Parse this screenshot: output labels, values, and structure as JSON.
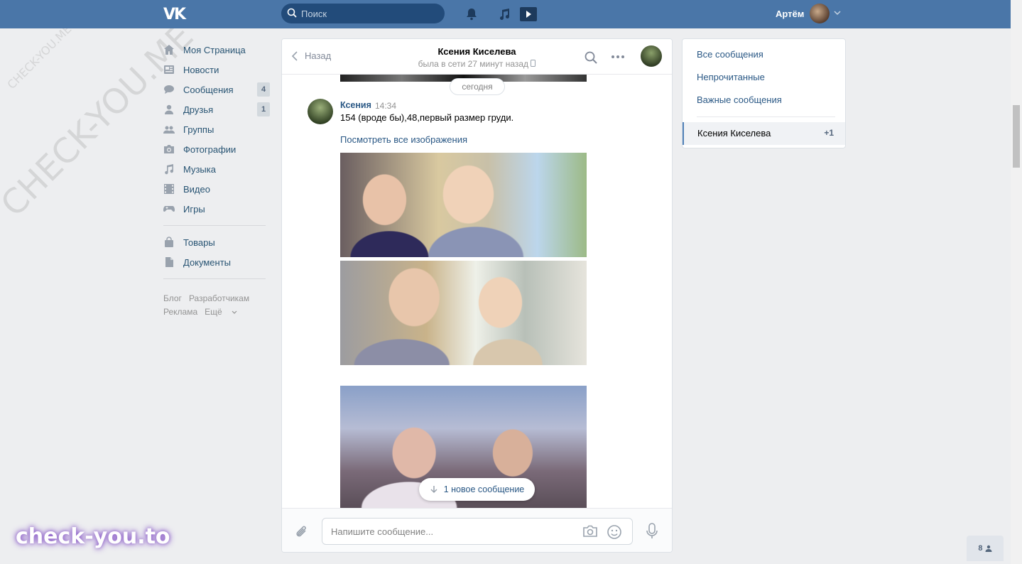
{
  "topbar": {
    "logo": "VK",
    "search_placeholder": "Поиск",
    "user_name": "Артём"
  },
  "sidebar": {
    "items": [
      {
        "label": "Моя Страница",
        "icon": "home-icon"
      },
      {
        "label": "Новости",
        "icon": "news-icon"
      },
      {
        "label": "Сообщения",
        "icon": "messages-icon",
        "count": "4"
      },
      {
        "label": "Друзья",
        "icon": "friends-icon",
        "count": "1"
      },
      {
        "label": "Группы",
        "icon": "groups-icon"
      },
      {
        "label": "Фотографии",
        "icon": "camera-icon"
      },
      {
        "label": "Музыка",
        "icon": "music-icon"
      },
      {
        "label": "Видео",
        "icon": "video-icon"
      },
      {
        "label": "Игры",
        "icon": "gamepad-icon"
      }
    ],
    "items2": [
      {
        "label": "Товары",
        "icon": "bag-icon"
      },
      {
        "label": "Документы",
        "icon": "document-icon"
      }
    ],
    "footer": {
      "blog": "Блог",
      "developers": "Разработчикам",
      "ads": "Реклама",
      "more": "Ещё"
    }
  },
  "chat": {
    "back_label": "Назад",
    "peer_name": "Ксения Киселева",
    "peer_status": "была в сети 27 минут назад",
    "date_divider": "сегодня",
    "message": {
      "author": "Ксения",
      "time": "14:34",
      "text": "154 (вроде бы),48,первый размер груди.",
      "view_all": "Посмотреть все изображения"
    },
    "new_message_label": "1 новое сообщение",
    "composer_placeholder": "Напишите сообщение..."
  },
  "right_panel": {
    "all_messages": "Все сообщения",
    "unread": "Непрочитанные",
    "important": "Важные сообщения",
    "active_chat": "Ксения Киселева",
    "active_badge": "+1"
  },
  "online_count": "8",
  "watermark": {
    "small": "CHECK-YOU.ME",
    "large": "CHECK-YOU.ME",
    "brand": "check-you.to"
  },
  "colors": {
    "header": "#4a76a8",
    "link": "#2a5885",
    "background": "#edeef0"
  }
}
